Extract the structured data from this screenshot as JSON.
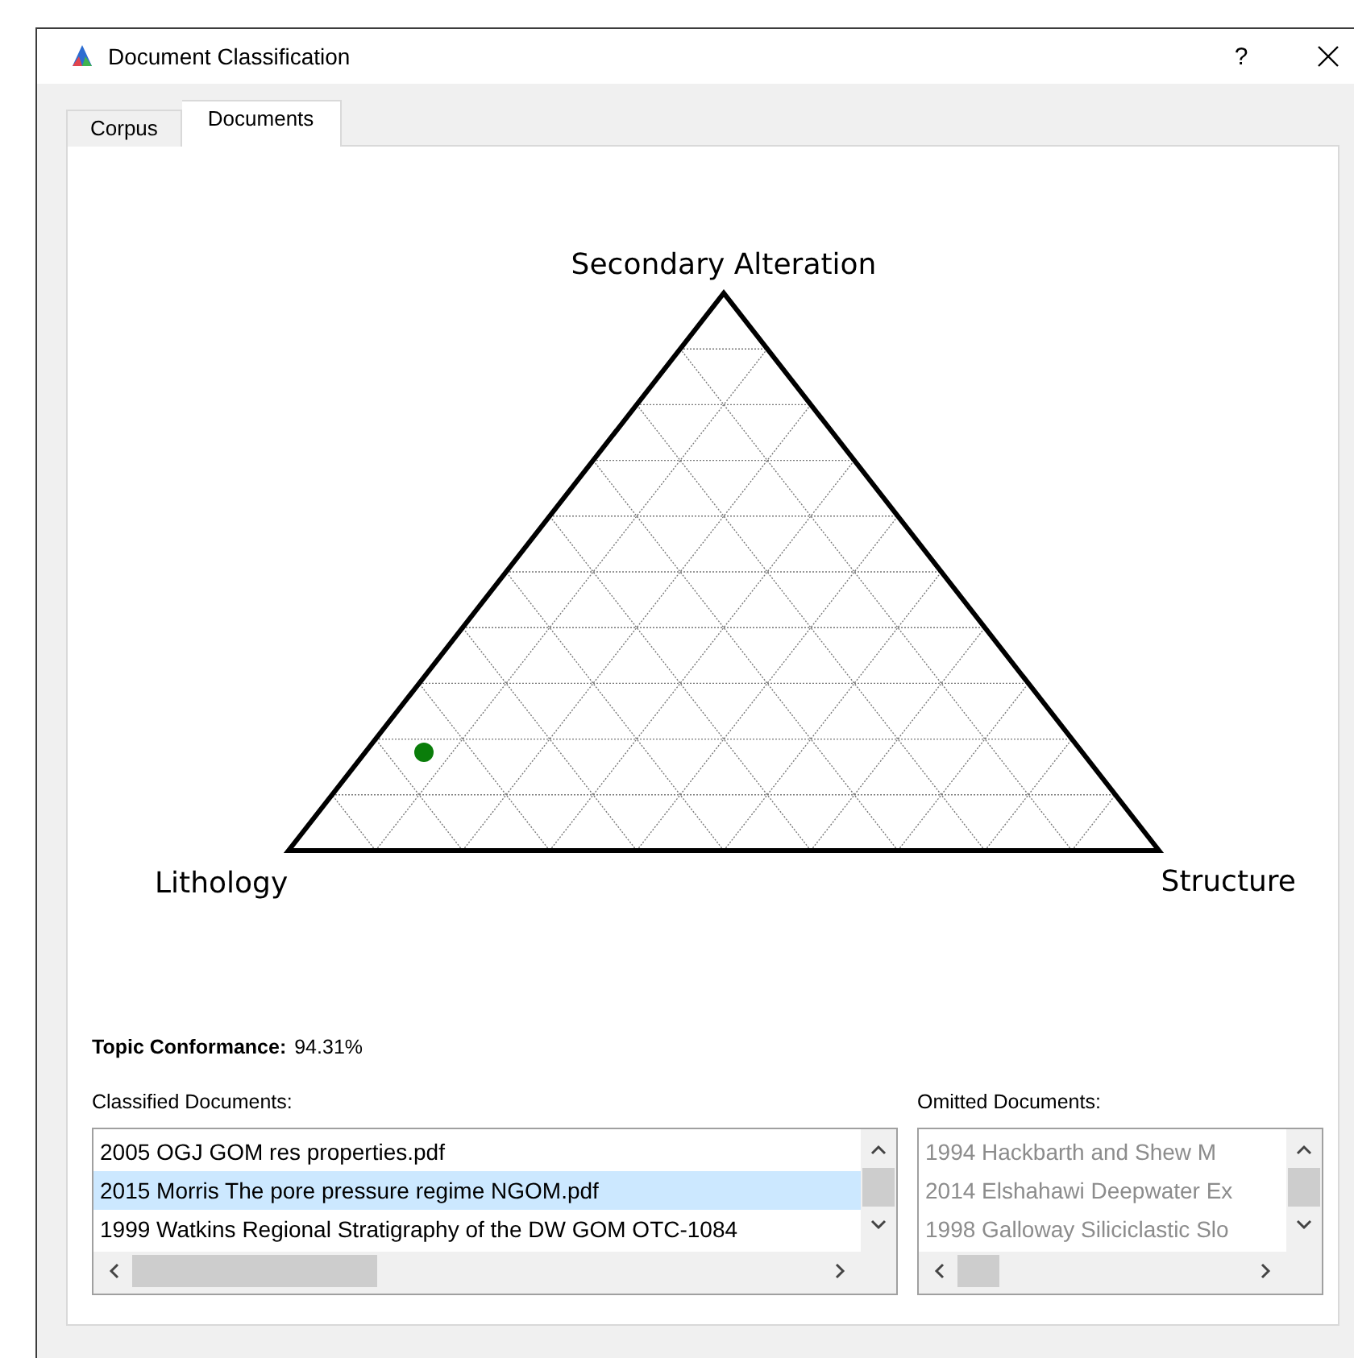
{
  "window": {
    "title": "Document Classification",
    "help": "?"
  },
  "tabs": [
    {
      "label": "Corpus",
      "selected": false
    },
    {
      "label": "Documents",
      "selected": true
    }
  ],
  "plot": {
    "top_label": "Secondary Alteration",
    "left_label": "Lithology",
    "right_label": "Structure"
  },
  "conformance": {
    "label": "Topic Conformance:",
    "value": "94.31%"
  },
  "lists": [
    {
      "label": "Classified Documents:",
      "disabled": false,
      "items": [
        {
          "text": "2005 OGJ GOM res properties.pdf",
          "selected": false
        },
        {
          "text": "2015 Morris The pore pressure regime NGOM.pdf",
          "selected": true
        },
        {
          "text": "1999 Watkins Regional Stratigraphy of the DW GOM OTC-1084",
          "selected": false
        }
      ]
    },
    {
      "label": "Omitted Documents:",
      "disabled": true,
      "items": [
        {
          "text": "1994 Hackbarth and Shew M",
          "selected": false
        },
        {
          "text": "2014 Elshahawi Deepwater Ex",
          "selected": false
        },
        {
          "text": "1998 Galloway Siliciclastic Slo",
          "selected": false
        }
      ]
    }
  ]
}
